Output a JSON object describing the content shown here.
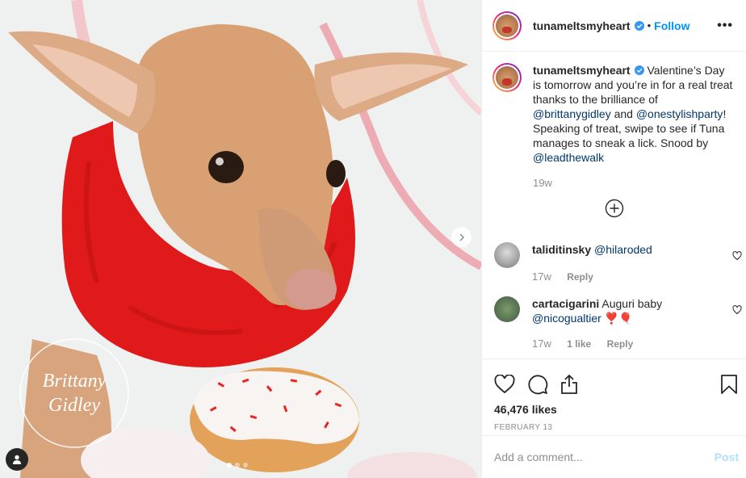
{
  "post": {
    "username": "tunameltsmyheart",
    "follow_label": "Follow",
    "bullet": "•",
    "more_label": "•••",
    "watermark_text": "Brittany Gidley"
  },
  "caption": {
    "username": "tunameltsmyheart",
    "text_1": " Valentine’s Day is tomorrow and you’re in for a real treat thanks to the brilliance of ",
    "mention_1": "@brittanygidley",
    "text_2": " and ",
    "mention_2": "@onestylishparty",
    "text_3": "! Speaking of treat, swipe to see if Tuna manages to sneak a lick. Snood by ",
    "mention_3": "@leadthewalk",
    "time": "19w"
  },
  "comments": [
    {
      "username": "taliditinsky",
      "mention": "@hilaroded",
      "text": "",
      "time": "17w",
      "likes": "",
      "reply": "Reply"
    },
    {
      "username": "cartacigarini",
      "text": " Auguri baby ",
      "mention": "@nicogualtier",
      "emoji": " ❣️🎈",
      "time": "17w",
      "likes": "1 like",
      "reply": "Reply"
    }
  ],
  "stats": {
    "likes": "46,476 likes",
    "date": "FEBRUARY 13"
  },
  "add_comment": {
    "placeholder": "Add a comment...",
    "post_label": "Post"
  },
  "carousel": {
    "slide_count": 3,
    "active_index": 0
  },
  "colors": {
    "link_blue": "#0095f6",
    "mention_blue": "#00376b",
    "post_disabled": "#b2dffc",
    "muted": "#8e8e8e"
  },
  "icons": [
    "chevron-right-icon",
    "user-tag-icon",
    "verified-badge-icon",
    "more-icon",
    "add-circle-icon",
    "heart-icon",
    "comment-icon",
    "share-icon",
    "bookmark-icon"
  ]
}
